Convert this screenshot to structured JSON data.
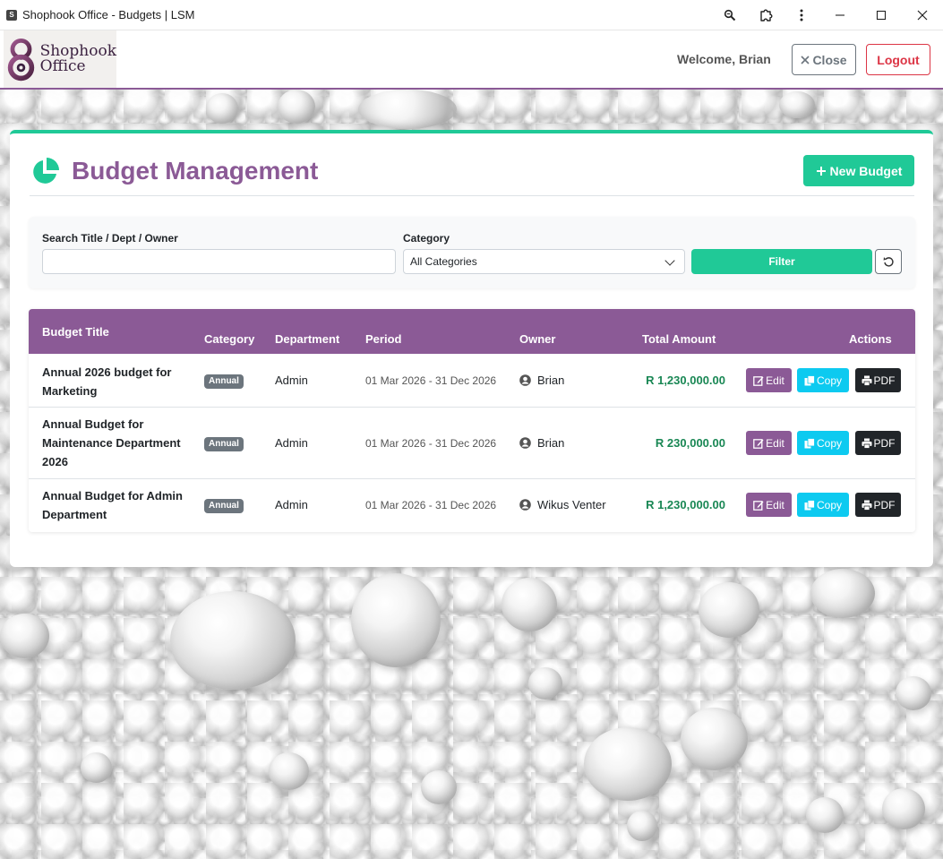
{
  "window": {
    "title": "Shophook Office - Budgets | LSM"
  },
  "header": {
    "logo_line1": "Shophook",
    "logo_line2": "Office",
    "welcome": "Welcome, Brian",
    "close_label": "Close",
    "logout_label": "Logout"
  },
  "page": {
    "title": "Budget Management",
    "new_button": "New Budget"
  },
  "filters": {
    "search_label": "Search Title / Dept / Owner",
    "search_value": "",
    "category_label": "Category",
    "category_selected": "All Categories",
    "filter_button": "Filter"
  },
  "table": {
    "columns": [
      "Budget Title",
      "Category",
      "Department",
      "Period",
      "Owner",
      "Total Amount",
      "Actions"
    ],
    "rows": [
      {
        "title": "Annual 2026 budget for Marketing",
        "category": "Annual",
        "department": "Admin",
        "period": "01 Mar 2026 - 31 Dec 2026",
        "owner": "Brian",
        "amount": "R 1,230,000.00"
      },
      {
        "title": "Annual Budget for Maintenance Department 2026",
        "category": "Annual",
        "department": "Admin",
        "period": "01 Mar 2026 - 31 Dec 2026",
        "owner": "Brian",
        "amount": "R 230,000.00"
      },
      {
        "title": "Annual Budget for Admin Department",
        "category": "Annual",
        "department": "Admin",
        "period": "01 Mar 2026 - 31 Dec 2026",
        "owner": "Wikus Venter",
        "amount": "R 1,230,000.00"
      }
    ],
    "actions": {
      "edit": "Edit",
      "copy": "Copy",
      "pdf": "PDF"
    }
  },
  "colors": {
    "brand": "#8b5a96",
    "accent": "#20c997",
    "danger": "#dc3545",
    "info": "#0dcaf0",
    "amount": "#198754"
  },
  "icons": [
    "zoom-icon",
    "extensions-icon",
    "more-icon",
    "minimize-icon",
    "maximize-icon",
    "close-window-icon",
    "pie-chart-icon",
    "plus-icon",
    "reset-icon",
    "user-icon",
    "edit-icon",
    "copy-icon",
    "print-icon"
  ]
}
